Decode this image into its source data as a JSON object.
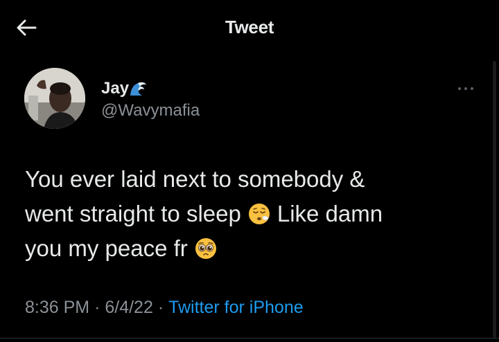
{
  "header": {
    "title": "Tweet"
  },
  "tweet": {
    "author": {
      "display_name": "Jay",
      "name_emoji": "water-wave-emoji",
      "handle": "@Wavymafia"
    },
    "text_lines": [
      {
        "before": "You ever laid next to somebody &",
        "emoji": null,
        "after": ""
      },
      {
        "before": "went straight to sleep",
        "emoji": "relieved-sleepy-face-emoji",
        "after": "Like damn"
      },
      {
        "before": "you my peace fr",
        "emoji": "pleading-face-emoji",
        "after": ""
      }
    ],
    "time": "8:36 PM",
    "date": "6/4/22",
    "separator": "·",
    "source": "Twitter for iPhone"
  },
  "colors": {
    "background": "#000000",
    "text_primary": "#e7e9ea",
    "text_secondary": "#8b9197",
    "link": "#1d9bf0"
  },
  "icons": {
    "back": "back-arrow-icon",
    "more": "more-options-icon"
  }
}
